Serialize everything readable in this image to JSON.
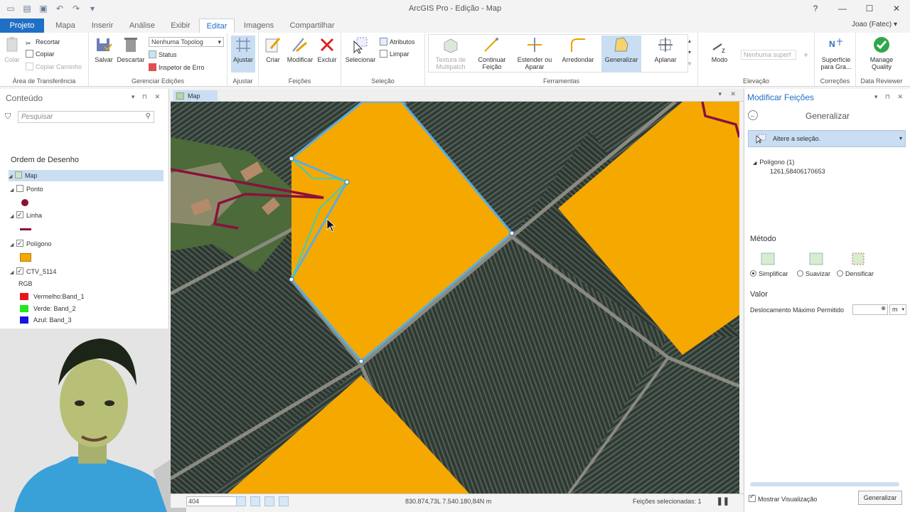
{
  "window": {
    "title": "ArcGIS Pro - Edição - Map",
    "controls": [
      "?",
      "—",
      "☐",
      "✕"
    ]
  },
  "tabs": [
    "Projeto",
    "Mapa",
    "Inserir",
    "Análise",
    "Exibir",
    "Editar",
    "Imagens",
    "Compartilhar"
  ],
  "user": "Joao (Fatec) ▾",
  "ribbon": {
    "clipboard": {
      "title": "Área de Transferência",
      "colar": "Colar",
      "recortar": "Recortar",
      "copiar": "Copiar",
      "copiar_caminho": "Copiar Caminho"
    },
    "manage_edits": {
      "title": "Gerenciar Edições",
      "salvar": "Salvar",
      "descartar": "Descartar",
      "topology_value": "Nenhuma Topolog",
      "status": "Status",
      "inspetor": "Inspetor de Erro"
    },
    "snapping": {
      "title": "Ajustar",
      "ajustar": "Ajustar"
    },
    "features": {
      "title": "Feições",
      "criar": "Criar",
      "modificar": "Modificar",
      "excluir": "Excluir"
    },
    "selection": {
      "title": "Seleção",
      "selecionar": "Selecionar",
      "atributos": "Atributos",
      "limpar": "Limpar"
    },
    "tools": {
      "title": "Ferramentas",
      "textura": "Textura de Multipatch",
      "continuar": "Continuar Feição",
      "estender": "Estender ou Aparar",
      "arredondar": "Arredondar",
      "generalizar": "Generalizar",
      "aplanar": "Aplanar"
    },
    "elevation": {
      "title": "Elevação",
      "modo": "Modo",
      "surface_value": "Nenhuma superf",
      "plus": "+"
    },
    "corrections": {
      "title": "Correções",
      "superficie": "Superfície para Gra..."
    },
    "data_reviewer": {
      "title": "Data Reviewer",
      "manage": "Manage Quality"
    }
  },
  "contents": {
    "title": "Conteúdo",
    "controls": "▾ ⊓ ✕",
    "search_placeholder": "Pesquisar",
    "section": "Ordem de Desenho",
    "layers": {
      "map": "Map",
      "ponto": "Ponto",
      "linha": "Linha",
      "poligono": "Polígono",
      "raster": "CTV_5114",
      "rgb": "RGB",
      "band1": "Vermelho:Band_1",
      "band2": "Verde: Band_2",
      "band3": "Azul: Band_3"
    },
    "colors": {
      "ponto": "#8b1030",
      "linha": "#8b1040",
      "poligono": "#f5a800",
      "band1": "#e8141c",
      "band2": "#1fe81f",
      "band3": "#1414e0"
    }
  },
  "map": {
    "tab_label": "Map",
    "tab_controls": "▾ ✕",
    "scale": "404",
    "coords": "830.874,73L 7.540.180,84N m",
    "selected": "Feições selecionadas: 1",
    "pause": "❚❚"
  },
  "modify": {
    "title": "Modificar Feições",
    "controls": "▾ ⊓ ✕",
    "tool": "Generalizar",
    "selection_prompt": "Altere a seleção.",
    "tree_node": "Polígono (1)",
    "feature_value": "1261,58406170653",
    "method_title": "Método",
    "methods": [
      "Simplificar",
      "Suavizar",
      "Densificar"
    ],
    "value_title": "Valor",
    "offset_label": "Deslocamento Máximo Permitido",
    "unit": "m",
    "preview": "Mostrar Visualização",
    "apply": "Generalizar"
  }
}
